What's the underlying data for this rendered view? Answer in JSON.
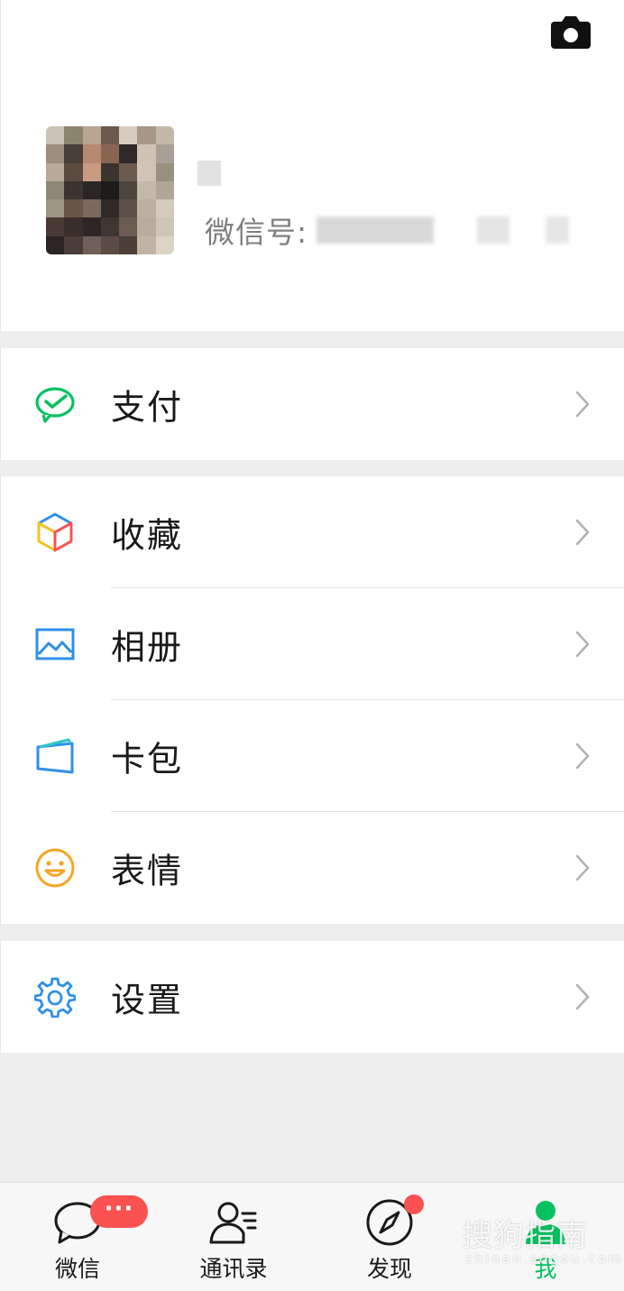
{
  "profile": {
    "wechat_id_label": "微信号:",
    "camera_icon": "camera-icon"
  },
  "menu": {
    "pay": {
      "label": "支付",
      "icon": "wechat-pay-icon",
      "color": "#07c160"
    },
    "favorites": {
      "label": "收藏",
      "icon": "favorites-cube-icon"
    },
    "album": {
      "label": "相册",
      "icon": "album-icon",
      "color": "#2f8fe8"
    },
    "cards": {
      "label": "卡包",
      "icon": "card-wallet-icon",
      "color": "#2f8fe8"
    },
    "stickers": {
      "label": "表情",
      "icon": "smiley-icon",
      "color": "#f5a623"
    },
    "settings": {
      "label": "设置",
      "icon": "gear-icon",
      "color": "#2f8fe8"
    }
  },
  "tabbar": {
    "tabs": [
      {
        "label": "微信",
        "icon": "chat-bubble-icon",
        "badge": "···"
      },
      {
        "label": "通讯录",
        "icon": "contacts-icon"
      },
      {
        "label": "发现",
        "icon": "compass-icon",
        "has_dot": true
      },
      {
        "label": "我",
        "icon": "me-person-icon",
        "active": true
      }
    ],
    "active_color": "#07c160",
    "badge_color": "#fa5151"
  },
  "watermark": {
    "text": "搜狗指南",
    "sub": "zhinan.sogou.com"
  }
}
